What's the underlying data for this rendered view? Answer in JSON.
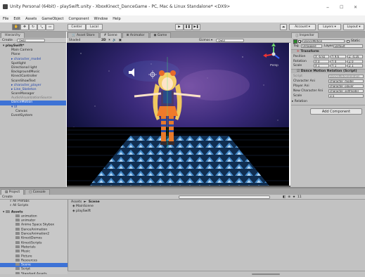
{
  "window": {
    "title": "Unity Personal (64bit) - playSwift.unity - XboxKinect_DanceGame - PC, Mac & Linux Standalone* <DX9>",
    "min": "–",
    "max": "☐",
    "close": "✕"
  },
  "menu": [
    "File",
    "Edit",
    "Assets",
    "GameObject",
    "Component",
    "Window",
    "Help"
  ],
  "toolbar": {
    "pivot": "Center",
    "space": "Local",
    "account": "Account",
    "layers": "Layers",
    "layout": "Layout"
  },
  "hierarchy": {
    "tab": "Hierarchy",
    "create": "Create",
    "search": "Q▾All",
    "items": [
      {
        "label": "playSwift*",
        "level": "lvl0",
        "style": "bold"
      },
      {
        "label": "Main Camera",
        "level": "lvl1",
        "style": ""
      },
      {
        "label": "Plane",
        "level": "lvl1",
        "style": ""
      },
      {
        "label": "character_model",
        "level": "lvl1",
        "style": "blue"
      },
      {
        "label": "Spotlight",
        "level": "lvl1",
        "style": ""
      },
      {
        "label": "Directional light",
        "level": "lvl1",
        "style": ""
      },
      {
        "label": "BackgroundMusic",
        "level": "lvl1",
        "style": ""
      },
      {
        "label": "KinectController",
        "level": "lvl1",
        "style": ""
      },
      {
        "label": "ScoreShowText",
        "level": "lvl1",
        "style": ""
      },
      {
        "label": "character_player",
        "level": "lvl1",
        "style": "blue"
      },
      {
        "label": "Line_Skeleton",
        "level": "lvl1",
        "style": "blue"
      },
      {
        "label": "ScoreManager",
        "level": "lvl1",
        "style": ""
      },
      {
        "label": "AudioVisualizationSource",
        "level": "lvl1",
        "style": "faint"
      },
      {
        "label": "DanceMotion",
        "level": "lvl1",
        "style": "sel"
      },
      {
        "label": "UI",
        "level": "lvl1",
        "style": "blue"
      },
      {
        "label": "Canvas",
        "level": "lvl1",
        "style": "sub"
      },
      {
        "label": "EventSystem",
        "level": "lvl1",
        "style": ""
      }
    ]
  },
  "center_tabs": [
    "Asset Store",
    "Scene",
    "Animator",
    "Game"
  ],
  "scene_toolbar": {
    "shading": "Shaded",
    "mode": "2D",
    "gizmos": "Gizmos ▾",
    "search": "Q▾All"
  },
  "scene_gizmo": {
    "persp": "Persp"
  },
  "inspector": {
    "tab": "Inspector",
    "object_name": "DanceMotion",
    "static_label": "Static",
    "tag_label": "Tag",
    "tag_value": "Untagged",
    "layer_label": "Layer",
    "layer_value": "Default",
    "transform": {
      "header": "Transform",
      "rows": [
        {
          "label": "Position",
          "x": "X -6.92",
          "y": "Y 9.6",
          "z": "Z -4.16"
        },
        {
          "label": "Rotation",
          "x": "X 0",
          "y": "Y 0",
          "z": "Z 0"
        },
        {
          "label": "Scale",
          "x": "X 1",
          "y": "Y 1",
          "z": "Z 1"
        }
      ]
    },
    "script_comp": {
      "header": "Dance Motion Relation (Script)",
      "script_label": "Script",
      "script_value": "DanceMotionRelation",
      "fields": [
        {
          "label": "Character Ani",
          "value": "character_model"
        },
        {
          "label": "Player Ani",
          "value": "character_player"
        },
        {
          "label": "New Character Ani",
          "value": "character_selfmodel"
        },
        {
          "label": "Scale",
          "value": "3.5"
        }
      ]
    },
    "relation": "Relation",
    "add_component": "Add Component"
  },
  "project": {
    "tabs": [
      "Project",
      "Console"
    ],
    "create": "Create",
    "favorites": [
      "All Prefabs",
      "All Scripts"
    ],
    "assets_root": "Assets",
    "folders": [
      "animation",
      "animator",
      "Anime Space Skybox",
      "DanceAnimation",
      "DanceAnimation2",
      "KinectDemos",
      "KinectScripts",
      "Materials",
      "Music",
      "Picture",
      "Resources",
      "Scene",
      "Script",
      "Standard Assets"
    ],
    "selected_folder": "Scene",
    "breadcrumb_root": "Assets",
    "breadcrumb_leaf": "Scene",
    "files": [
      "MainScene",
      "playSwift"
    ],
    "count": "11"
  },
  "colors": {
    "selection": "#3d72d6",
    "panel": "#c2c2c2",
    "scene_sky": "#1a1a4a"
  }
}
